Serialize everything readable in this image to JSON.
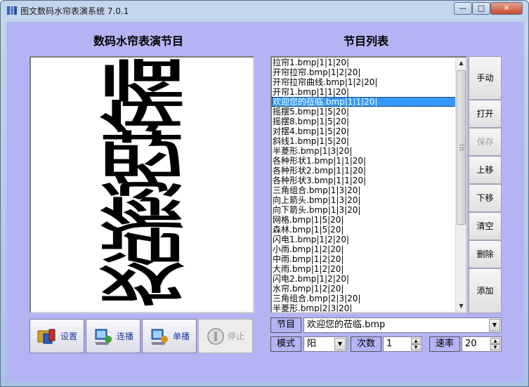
{
  "window": {
    "title": "图文数码水帘表演系统 7.0.1",
    "minimize": "—",
    "maximize": "□",
    "close": "✕"
  },
  "left": {
    "heading": "数码水帘表演节目",
    "display_text": [
      "临",
      "莅",
      "的",
      "您",
      "迎",
      "欢"
    ]
  },
  "right": {
    "heading": "节目列表"
  },
  "playlist": [
    "拉帘1.bmp|1|1|20|",
    "开帘拉帘.bmp|1|2|20|",
    "开帘拉帘曲线.bmp|1|2|20|",
    "开帘1.bmp|1|1|20|",
    "欢迎您的莅临.bmp|1|1|20|",
    "摇摆5.bmp|1|5|20|",
    "摇摆8.bmp|1|5|20|",
    "对摆4.bmp|1|5|20|",
    "斜线1.bmp|1|5|20|",
    "半菱形.bmp|1|3|20|",
    "各种形状1.bmp|1|1|20|",
    "各种形状2.bmp|1|1|20|",
    "各种形状3.bmp|1|1|20|",
    "三角组合.bmp|1|3|20|",
    "向上箭头.bmp|1|3|20|",
    "向下箭头.bmp|1|3|20|",
    "网格.bmp|1|5|20|",
    "森林.bmp|1|5|20|",
    "闪电1.bmp|1|2|20|",
    "小雨.bmp|1|2|20|",
    "中雨.bmp|1|2|20|",
    "大雨.bmp|1|2|20|",
    "闪电2.bmp|1|2|20|",
    "水帘.bmp|1|2|20|",
    "三角组合.bmp|2|3|20|",
    "半菱形.bmp|2|3|20|"
  ],
  "selected_index": 4,
  "actions": {
    "manual": "手动",
    "open": "打开",
    "save": "保存",
    "up": "上移",
    "down": "下移",
    "clear": "清空",
    "delete": "删除",
    "add": "添加"
  },
  "buttons": {
    "settings": "设置",
    "loop_play": "连播",
    "single_play": "单播",
    "stop": "停止"
  },
  "program": {
    "label": "节目",
    "value": "欢迎您的莅临.bmp"
  },
  "mode": {
    "label": "模式",
    "value": "阳"
  },
  "count": {
    "label": "次数",
    "value": "1"
  },
  "speed": {
    "label": "速率",
    "value": "20"
  }
}
